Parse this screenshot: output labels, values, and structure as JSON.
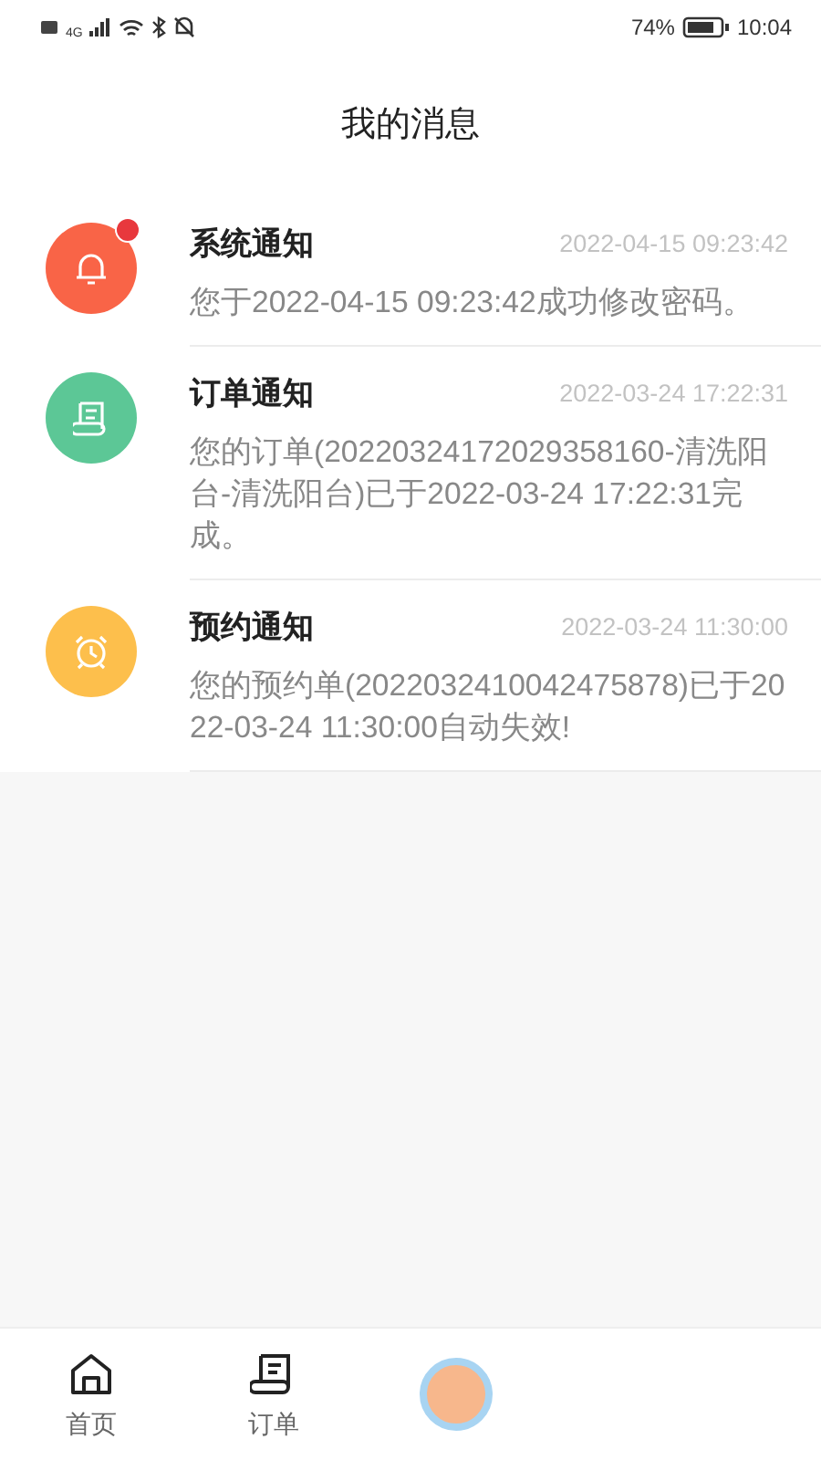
{
  "status_bar": {
    "network": "4G",
    "battery": "74%",
    "time": "10:04"
  },
  "header": {
    "title": "我的消息"
  },
  "messages": [
    {
      "kind": "bell",
      "color": "#f96447",
      "unread": true,
      "title": "系统通知",
      "time": "2022-04-15 09:23:42",
      "body": "您于2022-04-15 09:23:42成功修改密码。"
    },
    {
      "kind": "document",
      "color": "#5cc796",
      "unread": false,
      "title": "订单通知",
      "time": "2022-03-24 17:22:31",
      "body": "您的订单(20220324172029358160-清洗阳台-清洗阳台)已于2022-03-24 17:22:31完成。"
    },
    {
      "kind": "alarm",
      "color": "#fdbf4c",
      "unread": false,
      "title": "预约通知",
      "time": "2022-03-24 11:30:00",
      "body": "您的预约单(2022032410042475878)已于2022-03-24 11:30:00自动失效!"
    }
  ],
  "tab_bar": [
    {
      "kind": "home",
      "label": "首页",
      "selected": false
    },
    {
      "kind": "document",
      "label": "订单",
      "selected": false
    },
    {
      "kind": "center"
    }
  ]
}
